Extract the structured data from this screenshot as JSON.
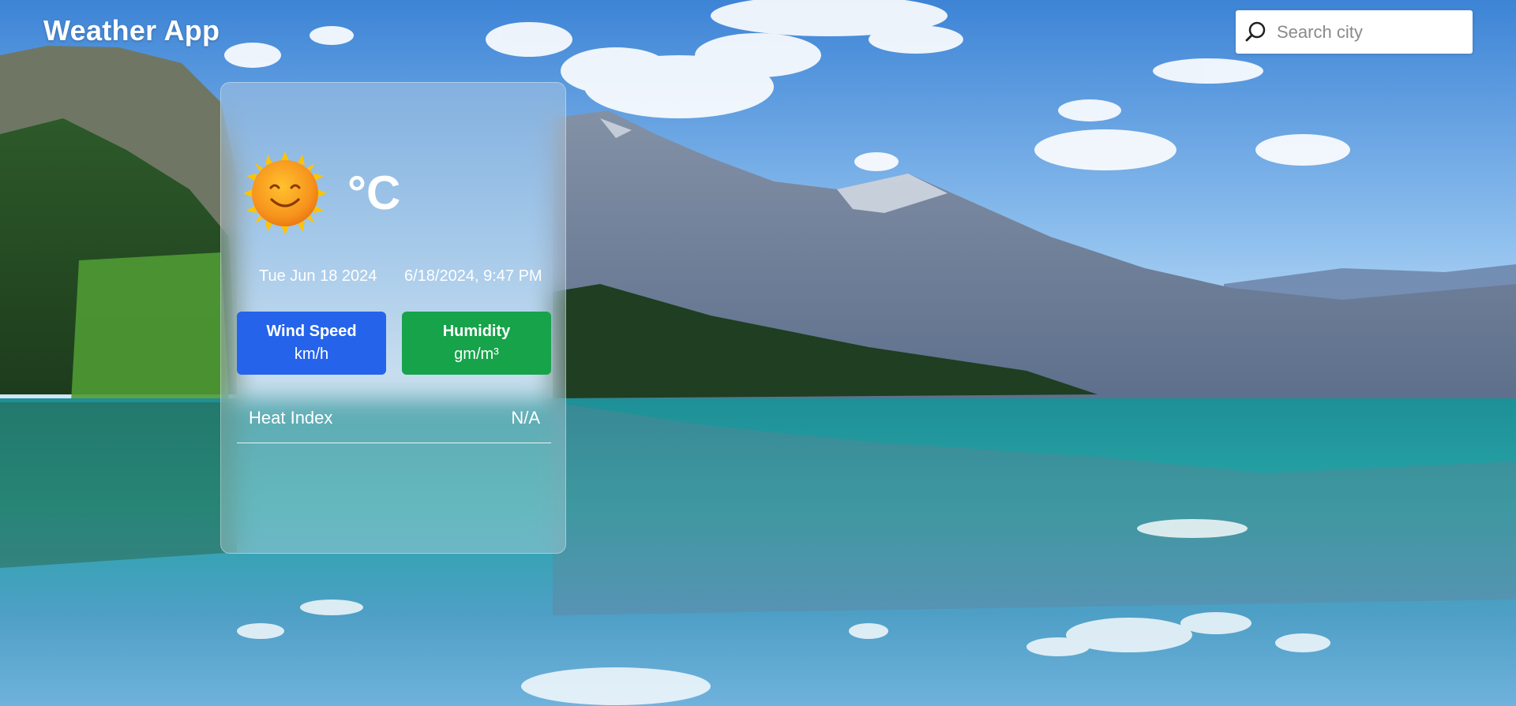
{
  "header": {
    "title": "Weather App"
  },
  "search": {
    "placeholder": "Search city",
    "value": ""
  },
  "weather": {
    "icon": "sun-smiling-icon",
    "temperature_unit": "°C",
    "date": "Tue Jun 18 2024",
    "datetime": "6/18/2024, 9:47 PM",
    "wind": {
      "label": "Wind Speed",
      "unit": "km/h",
      "color": "#2563eb"
    },
    "humidity": {
      "label": "Humidity",
      "unit": "gm/m³",
      "color": "#16a34a"
    },
    "heat_index": {
      "label": "Heat Index",
      "value": "N/A"
    }
  }
}
